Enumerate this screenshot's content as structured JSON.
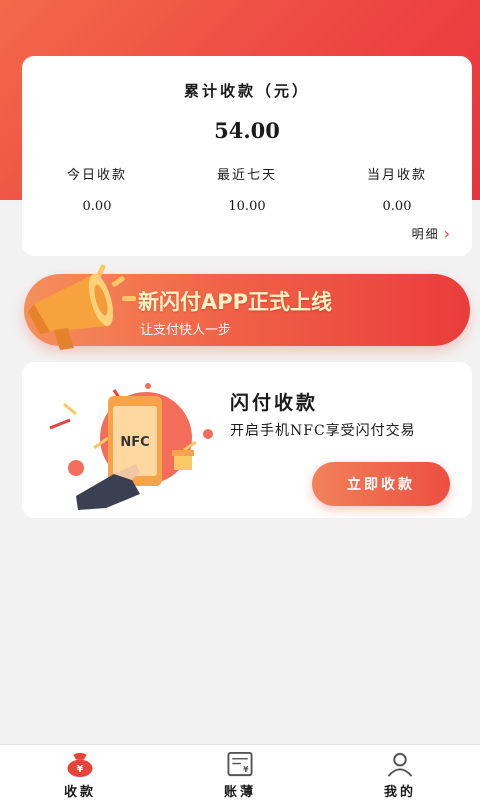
{
  "summary": {
    "title": "累计收款（元）",
    "amount": "54.00",
    "stats": [
      {
        "label": "今日收款",
        "value": "0.00"
      },
      {
        "label": "最近七天",
        "value": "10.00"
      },
      {
        "label": "当月收款",
        "value": "0.00"
      }
    ],
    "detail_label": "明细",
    "detail_icon": "chevron-right-icon"
  },
  "banner": {
    "title": "新闪付APP正式上线",
    "subtitle": "让支付快人一步",
    "icon": "megaphone-icon"
  },
  "pay_card": {
    "title": "闪付收款",
    "description": "开启手机NFC享受闪付交易",
    "nfc_badge": "NFC",
    "button_label": "立即收款"
  },
  "tabbar": {
    "items": [
      {
        "label": "收款",
        "icon": "money-bag-icon",
        "active": true
      },
      {
        "label": "账薄",
        "icon": "ledger-icon",
        "active": false
      },
      {
        "label": "我的",
        "icon": "user-icon",
        "active": false
      }
    ]
  },
  "colors": {
    "brand_red": "#e8433a",
    "header_gradient_start": "#f36a4a",
    "header_gradient_end": "#e8323c",
    "banner_title": "#fff3c6"
  }
}
